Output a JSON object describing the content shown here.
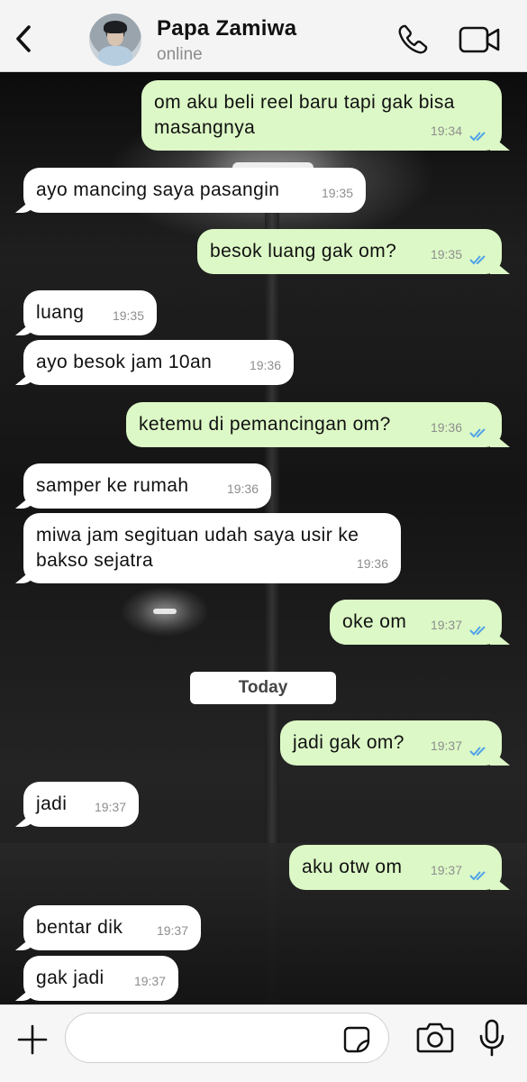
{
  "header": {
    "contact_name": "Papa Zamiwa",
    "status": "online",
    "icons": [
      "chevron-left-icon",
      "avatar",
      "phone-icon",
      "video-camera-icon"
    ]
  },
  "messages": [
    {
      "direction": "outgoing",
      "text": "om aku beli reel baru tapi gak bisa masangnya",
      "time": "19:34",
      "read": true
    },
    {
      "direction": "incoming",
      "text": "ayo mancing saya pasangin",
      "time": "19:35"
    },
    {
      "direction": "outgoing",
      "text": "besok luang gak om?",
      "time": "19:35",
      "read": true
    },
    {
      "direction": "incoming",
      "text": "luang",
      "time": "19:35"
    },
    {
      "direction": "incoming",
      "text": "ayo besok jam 10an",
      "time": "19:36"
    },
    {
      "direction": "outgoing",
      "text": "ketemu di pemancingan om?",
      "time": "19:36",
      "read": true
    },
    {
      "direction": "incoming",
      "text": "samper ke rumah",
      "time": "19:36"
    },
    {
      "direction": "incoming",
      "text": "miwa jam segituan udah saya usir ke bakso sejatra",
      "time": "19:36"
    },
    {
      "direction": "outgoing",
      "text": "oke om",
      "time": "19:37",
      "read": true
    },
    {
      "direction": "outgoing",
      "text": "jadi gak om?",
      "time": "19:37",
      "read": true
    },
    {
      "direction": "incoming",
      "text": "jadi",
      "time": "19:37"
    },
    {
      "direction": "outgoing",
      "text": "aku otw om",
      "time": "19:37",
      "read": true
    },
    {
      "direction": "incoming",
      "text": "bentar dik",
      "time": "19:37"
    },
    {
      "direction": "incoming",
      "text": "gak jadi",
      "time": "19:37"
    }
  ],
  "day_separator": "Today",
  "composer": {
    "placeholder": "",
    "icons": [
      "plus-icon",
      "sticker-icon",
      "camera-icon",
      "microphone-icon"
    ]
  },
  "colors": {
    "outgoing_bubble": "#dcf8c6",
    "incoming_bubble": "#ffffff",
    "read_ticks": "#4fa3e8",
    "header_bg": "#f4f4f5"
  }
}
